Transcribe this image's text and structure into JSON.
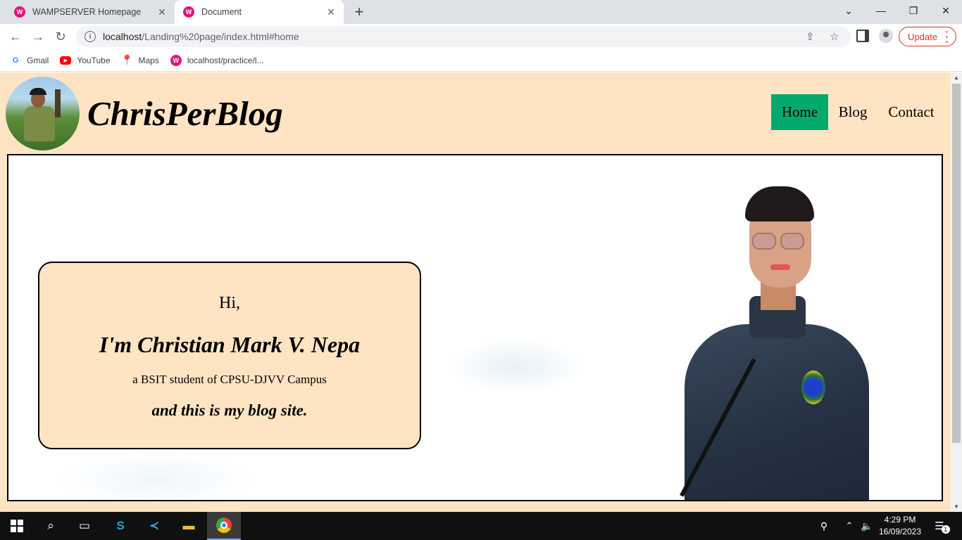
{
  "browser": {
    "tabs": [
      {
        "title": "WAMPSERVER Homepage",
        "active": false
      },
      {
        "title": "Document",
        "active": true
      }
    ],
    "url_host": "localhost",
    "url_path": "/Landing%20page/index.html#home",
    "update_label": "Update",
    "bookmarks": [
      {
        "label": "Gmail",
        "icon": "google-icon"
      },
      {
        "label": "YouTube",
        "icon": "youtube-icon"
      },
      {
        "label": "Maps",
        "icon": "maps-icon"
      },
      {
        "label": "localhost/practice/l...",
        "icon": "wampserver-icon"
      }
    ]
  },
  "page": {
    "brand": "ChrisPerBlog",
    "nav": [
      {
        "label": "Home",
        "active": true
      },
      {
        "label": "Blog",
        "active": false
      },
      {
        "label": "Contact",
        "active": false
      }
    ],
    "hero": {
      "greeting": "Hi,",
      "name": "I'm Christian Mark V. Nepa",
      "subtitle": "a BSIT student of CPSU-DJVV Campus",
      "tagline": "and this is my blog site."
    },
    "colors": {
      "page_bg": "#ffe4c4",
      "nav_active": "#04aa6d"
    }
  },
  "taskbar": {
    "time": "4:29 PM",
    "date": "16/09/2023",
    "notification_count": "1"
  }
}
